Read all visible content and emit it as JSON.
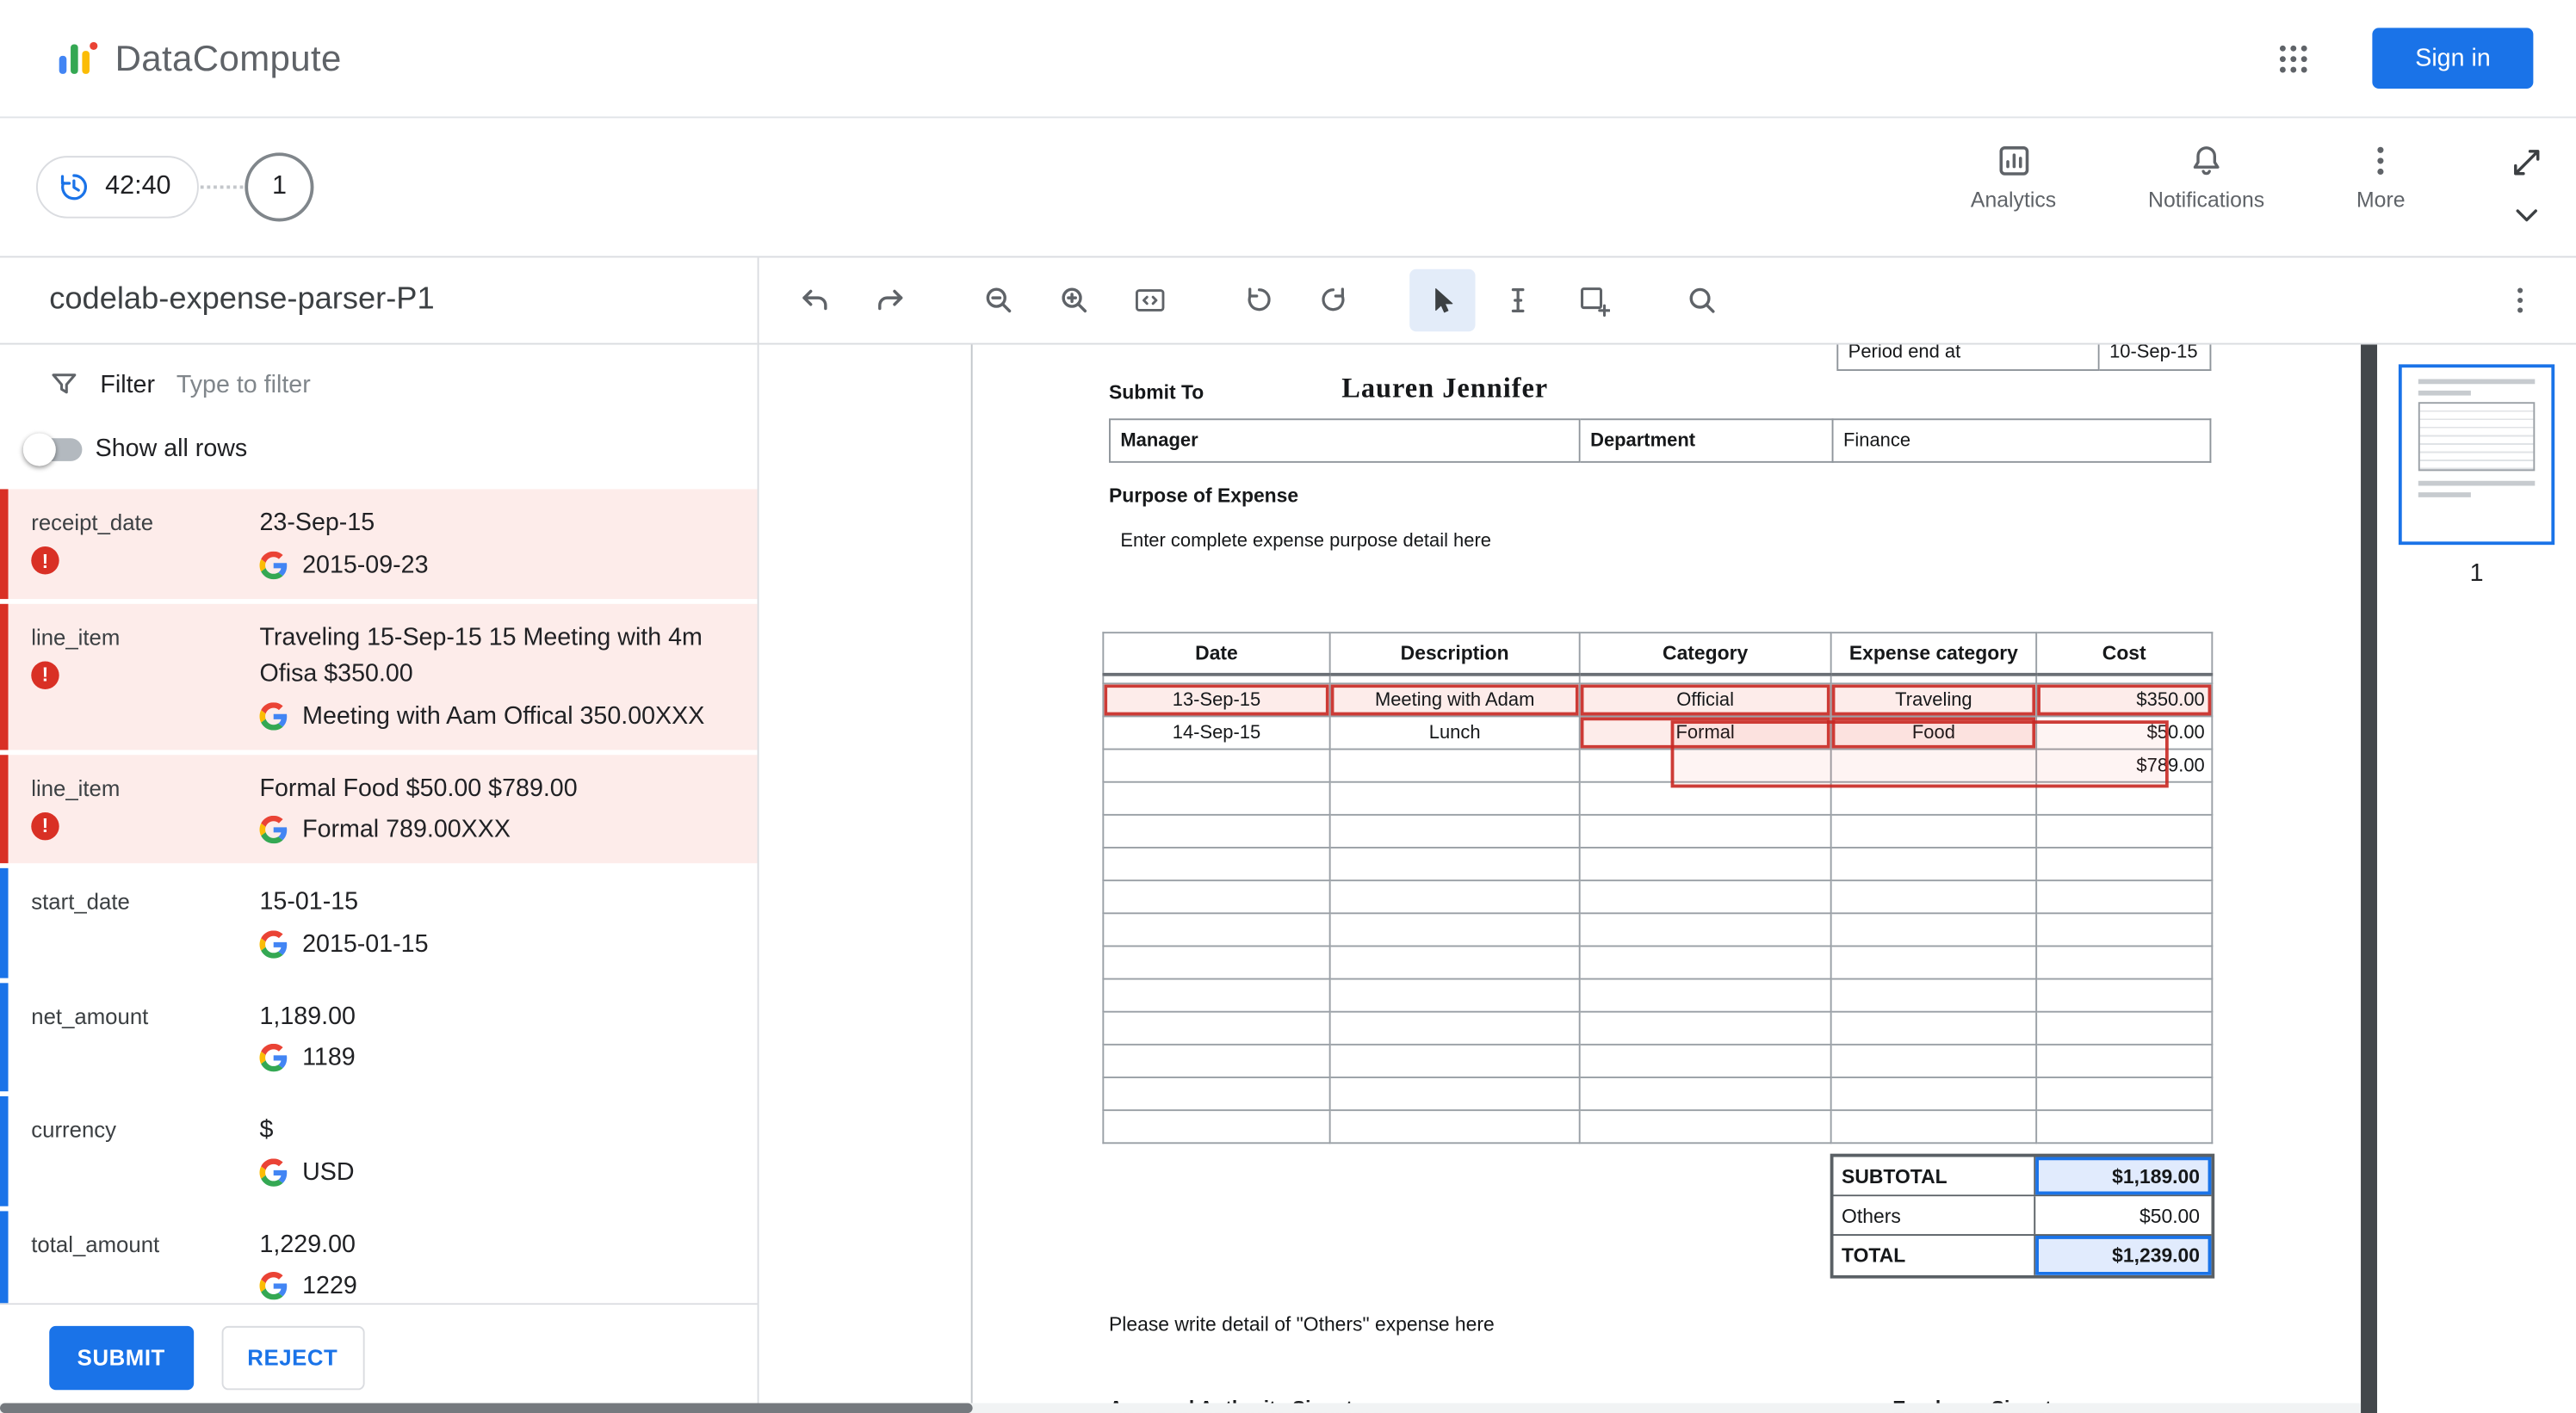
{
  "header": {
    "brand": "DataCompute",
    "sign_in": "Sign in"
  },
  "taskbar": {
    "timer": "42:40",
    "step": "1",
    "analytics_label": "Analytics",
    "notifications_label": "Notifications",
    "more_label": "More"
  },
  "sidebar": {
    "title": "codelab-expense-parser-P1",
    "filter_label": "Filter",
    "filter_placeholder": "Type to filter",
    "show_all_rows_label": "Show all rows",
    "fields": [
      {
        "key": "receipt_date",
        "status": "error",
        "value": "23-Sep-15",
        "normalized": "2015-09-23"
      },
      {
        "key": "line_item",
        "status": "error",
        "value": "Traveling 15-Sep-15 15 Meeting with 4m Ofisa $350.00",
        "normalized": "Meeting with Aam Offical 350.00XXX"
      },
      {
        "key": "line_item",
        "status": "error",
        "value": "Formal Food $50.00 $789.00",
        "normalized": "Formal 789.00XXX"
      },
      {
        "key": "start_date",
        "status": "ok",
        "value": "15-01-15",
        "normalized": "2015-01-15"
      },
      {
        "key": "net_amount",
        "status": "ok",
        "value": "1,189.00",
        "normalized": "1189"
      },
      {
        "key": "currency",
        "status": "ok",
        "value": "$",
        "normalized": "USD"
      },
      {
        "key": "total_amount",
        "status": "ok",
        "value": "1,229.00",
        "normalized": "1229"
      }
    ],
    "submit_label": "SUBMIT",
    "reject_label": "REJECT"
  },
  "document": {
    "period_label": "Period end at",
    "period_value": "10-Sep-15",
    "submit_to_label": "Submit To",
    "submit_to_value": "Lauren Jennifer",
    "manager_label": "Manager",
    "department_label": "Department",
    "department_value": "Finance",
    "purpose_heading": "Purpose of Expense",
    "purpose_hint": "Enter complete expense  purpose detail here",
    "table": {
      "headers": [
        "Date",
        "Description",
        "Category",
        "Expense category",
        "Cost"
      ],
      "rows": [
        [
          "13-Sep-15",
          "Meeting with Adam",
          "Official",
          "Traveling",
          "$350.00"
        ],
        [
          "14-Sep-15",
          "Lunch",
          "Formal",
          "Food",
          "$50.00"
        ],
        [
          "",
          "",
          "",
          "",
          "$789.00"
        ]
      ],
      "empty_row_count": 11
    },
    "summary": {
      "subtotal_label": "SUBTOTAL",
      "subtotal_value": "$1,189.00",
      "others_label": "Others",
      "others_value": "$50.00",
      "total_label": "TOTAL",
      "total_value": "$1,239.00"
    },
    "others_note": "Please write detail of \"Others\" expense here",
    "approval_signature_label": "Approval Authority Signature",
    "employee_signature_label": "Employee Signature"
  },
  "thumbnails": {
    "page_number": "1"
  }
}
